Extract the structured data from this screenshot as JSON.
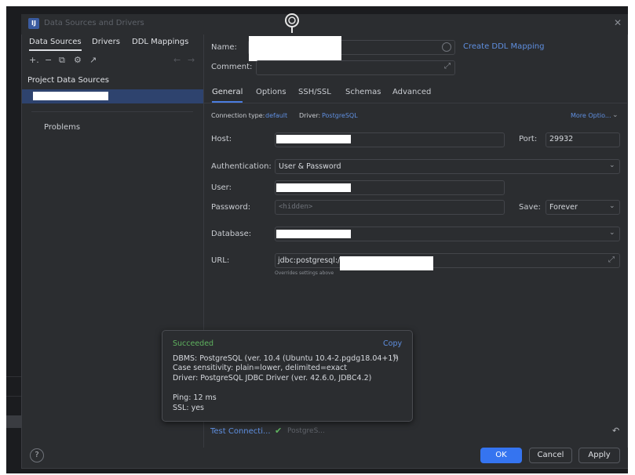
{
  "window": {
    "title": "Data Sources and Drivers"
  },
  "left_tabs": [
    {
      "label": "Data Sources"
    },
    {
      "label": "Drivers"
    },
    {
      "label": "DDL Mappings"
    }
  ],
  "toolbar_icons": [
    "add-icon",
    "remove-icon",
    "duplicate-icon",
    "settings-icon",
    "export-icon",
    "back-arrow-icon",
    "forward-arrow-icon"
  ],
  "left": {
    "section_label": "Project Data Sources",
    "problems_label": "Problems"
  },
  "form": {
    "name_label": "Name:",
    "comment_label": "Comment:",
    "create_ddl_link": "Create DDL Mapping",
    "tabs": [
      {
        "label": "General"
      },
      {
        "label": "Options"
      },
      {
        "label": "SSH/SSL"
      },
      {
        "label": "Schemas"
      },
      {
        "label": "Advanced"
      }
    ],
    "connection_type_label": "Connection type:",
    "connection_type_value": "default",
    "driver_label": "Driver:",
    "driver_value": "PostgreSQL",
    "more_options": "More Optio...",
    "host_label": "Host:",
    "port_label": "Port:",
    "port_value": "29932",
    "auth_label": "Authentication:",
    "auth_value": "User & Password",
    "user_label": "User:",
    "password_label": "Password:",
    "password_placeholder": "<hidden>",
    "save_label": "Save:",
    "save_value": "Forever",
    "database_label": "Database:",
    "url_label": "URL:",
    "url_value": "jdbc:postgresql:/",
    "url_hint": "Overrides settings above"
  },
  "popup": {
    "status": "Succeeded",
    "copy": "Copy",
    "dbms": "DBMS: PostgreSQL (ver. 10.4 (Ubuntu 10.4-2.pgdg18.04+1))",
    "case": "Case sensitivity: plain=lower, delimited=exact",
    "driver": "Driver: PostgreSQL JDBC Driver (ver. 42.6.0, JDBC4.2)",
    "ping": "Ping: 12 ms",
    "ssl": "SSL: yes"
  },
  "footer": {
    "test_connection": "Test Connecti...",
    "test_status": "PostgreS...",
    "ok": "OK",
    "cancel": "Cancel",
    "apply": "Apply",
    "help": "?"
  },
  "colors": {
    "accent": "#3574f0",
    "link": "#5f8fe0",
    "success": "#5fb35f",
    "background": "#2b2d30"
  }
}
